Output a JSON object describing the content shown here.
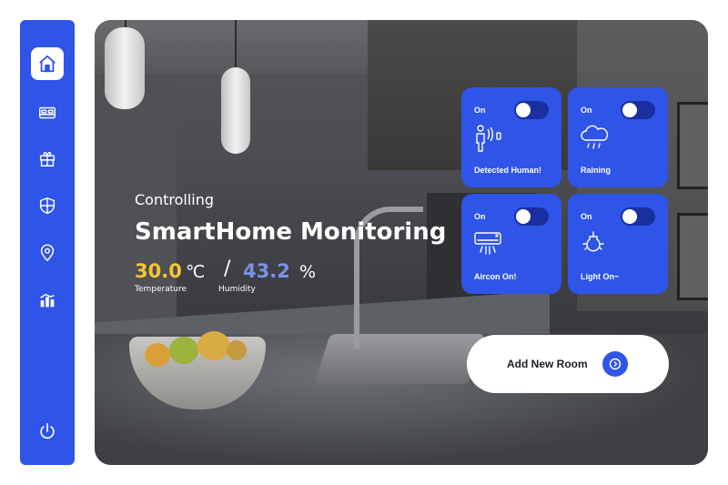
{
  "sidebar": {
    "accent": "#2f54e8",
    "items": [
      {
        "icon": "home-icon",
        "active": true
      },
      {
        "icon": "bed-icon",
        "active": false
      },
      {
        "icon": "gift-icon",
        "active": false
      },
      {
        "icon": "shield-icon",
        "active": false
      },
      {
        "icon": "location-pin-icon",
        "active": false
      },
      {
        "icon": "analytics-icon",
        "active": false
      },
      {
        "icon": "power-icon",
        "active": false
      }
    ]
  },
  "hero": {
    "subtitle": "Controlling",
    "title": "SmartHome Monitoring",
    "temperature": {
      "value": "30.0",
      "unit": "℃",
      "label": "Temperature",
      "color": "#f5c531"
    },
    "separator": "/",
    "humidity": {
      "value": "43.2",
      "unit": "%",
      "label": "Humidity",
      "color": "#7a92e8"
    }
  },
  "cards": [
    {
      "state": "On",
      "label": "Detected Human!",
      "icon": "person-sensor-icon"
    },
    {
      "state": "On",
      "label": "Raining",
      "icon": "rain-cloud-icon"
    },
    {
      "state": "On",
      "label": "Aircon On!",
      "icon": "air-conditioner-icon"
    },
    {
      "state": "On",
      "label": "Light On~",
      "icon": "light-bulb-icon"
    }
  ],
  "add_room": {
    "label": "Add New Room",
    "icon": "arrow-right-circle-icon"
  }
}
